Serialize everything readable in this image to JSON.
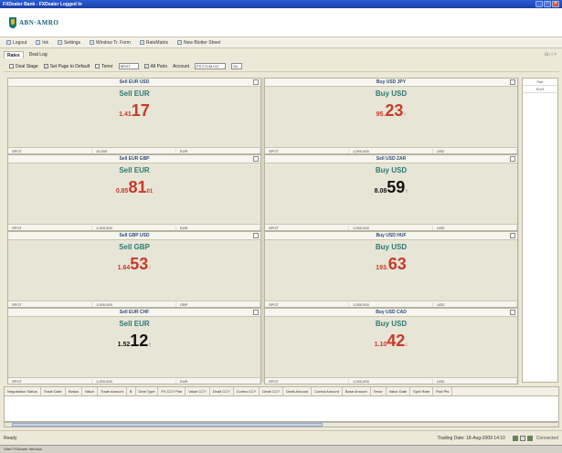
{
  "window": {
    "title": "FXDealer Bank - FXDealer Logged In",
    "controls": [
      "_",
      "□",
      "×"
    ]
  },
  "brand": {
    "name": "ABN·AMRO"
  },
  "menu": {
    "items": [
      "Logout",
      "Ink",
      "Settings",
      "Window Tr. Form",
      "RateMatrix",
      "New Blotter Sheet"
    ]
  },
  "tabs": {
    "items": [
      "Rates",
      "Deal Log"
    ],
    "controls": "⊟ □ ×"
  },
  "toolbar": {
    "deal_stage_label": "Deal Stage",
    "auto_cb_label": "Set Page to Default",
    "tenor_label": "Tenor",
    "tenor_value": "SPOT",
    "size_label": "All Pairs",
    "account_label": "Account",
    "account_value": "FX CTLM CO",
    "refresh_label": "Go"
  },
  "tiles": [
    {
      "pair": "Sell EUR USD",
      "side": "Sell EUR",
      "small": "1.41",
      "big": "17",
      "arrow": "",
      "color": "red",
      "foot": [
        "SPOT",
        "10,000",
        "EUR"
      ]
    },
    {
      "pair": "Buy USD JPY",
      "side": "Buy USD",
      "small": "95.",
      "big": "23",
      "arrow": "↑",
      "color": "red",
      "foot": [
        "SPOT",
        "1,000,000",
        "USD"
      ]
    },
    {
      "pair": "Sell EUR GBP",
      "side": "Sell EUR",
      "small": "0.85",
      "big": "81",
      "arrow": "01",
      "color": "red",
      "foot": [
        "SPOT",
        "1,000,000",
        "EUR"
      ]
    },
    {
      "pair": "Sell USD ZAR",
      "side": "Buy USD",
      "small": "8.08",
      "big": "59",
      "arrow": "↑",
      "color": "black",
      "foot": [
        "SPOT",
        "1,000,000",
        "USD"
      ]
    },
    {
      "pair": "Sell GBP USD",
      "side": "Sell GBP",
      "small": "1.64",
      "big": "53",
      "arrow": "↑",
      "color": "red",
      "foot": [
        "SPOT",
        "1,000,000",
        "GBP"
      ]
    },
    {
      "pair": "Buy USD HUF",
      "side": "Buy USD",
      "small": "193.",
      "big": "63",
      "arrow": "",
      "color": "red",
      "foot": [
        "SPOT",
        "1,000,000",
        "USD"
      ]
    },
    {
      "pair": "Sell EUR CHF",
      "side": "Sell EUR",
      "small": "1.52",
      "big": "12",
      "arrow": "↑",
      "color": "black",
      "foot": [
        "SPOT",
        "1,000,000",
        "EUR"
      ]
    },
    {
      "pair": "Buy USD CAD",
      "side": "Buy USD",
      "small": "1.10",
      "big": "42",
      "arrow": "↓",
      "color": "red",
      "foot": [
        "SPOT",
        "1,000,000",
        "USD"
      ]
    }
  ],
  "right_panel": {
    "rows": [
      "Pair",
      "EUR"
    ]
  },
  "blotter": {
    "columns": [
      "Negotiation Status",
      "Trade Date",
      "Status",
      "Value",
      "Trade Amount",
      "B",
      "Deal Type",
      "FX CCY Pair",
      "Value CCY",
      "Dealt CCY",
      "Contra CCY",
      "Dealt CCY",
      "Dealt Amount",
      "Contra Amount",
      "Base Amount",
      "Tenor",
      "Value Date",
      "Spot Rate",
      "Fwd Pts"
    ]
  },
  "status": {
    "left": "Ready",
    "date": "Trading Date: 18-Aug-2009 14:10",
    "connection": "Connected"
  },
  "taskbar": {
    "label": "Start FXDealer Window"
  }
}
